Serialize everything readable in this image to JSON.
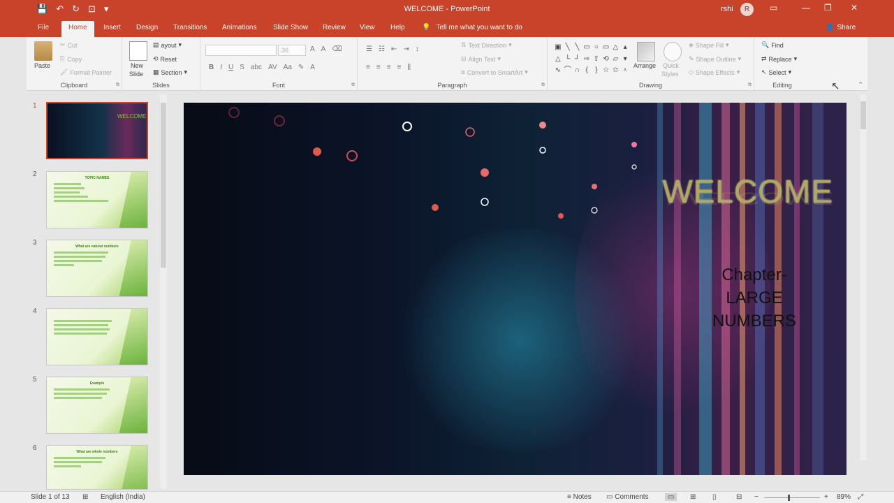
{
  "window": {
    "title": "WELCOME - PowerPoint",
    "user": "rshi",
    "avatar_initial": "R"
  },
  "qat": {
    "save_icon": "💾",
    "undo_icon": "↶",
    "redo_icon": "↻",
    "present_icon": "⊡",
    "more_icon": "▾"
  },
  "tabs": [
    "File",
    "Home",
    "Insert",
    "Design",
    "Transitions",
    "Animations",
    "Slide Show",
    "Review",
    "View",
    "Help"
  ],
  "tell_me": "Tell me what you want to do",
  "share": "Share",
  "ribbon": {
    "clipboard": {
      "label": "Clipboard",
      "paste": "Paste",
      "cut": "Cut",
      "copy": "Copy",
      "format_painter": "Format Painter"
    },
    "slides": {
      "label": "Slides",
      "new_slide": "New",
      "new_slide_2": "Slide",
      "layout": "ayout",
      "reset": "Reset",
      "section": "Section"
    },
    "font": {
      "label": "Font",
      "size": "36"
    },
    "paragraph": {
      "label": "Paragraph",
      "text_direction": "Text Direction",
      "align_text": "Align Text",
      "smartart": "Convert to SmartArt"
    },
    "drawing": {
      "label": "Drawing",
      "arrange": "Arrange",
      "quick_styles": "Quick",
      "quick_styles_2": "Styles",
      "shape_fill": "Shape Fill",
      "shape_outline": "Shape Outline",
      "shape_effects": "Shape Effects"
    },
    "editing": {
      "label": "Editing",
      "find": "Find",
      "replace": "Replace",
      "select": "Select"
    }
  },
  "thumbnails": [
    {
      "num": "1",
      "title": "WELCOME"
    },
    {
      "num": "2",
      "title": "TOPIC NAMES"
    },
    {
      "num": "3",
      "title": "What are natural numbers"
    },
    {
      "num": "4",
      "title": ""
    },
    {
      "num": "5",
      "title": "Example"
    },
    {
      "num": "6",
      "title": "What are whole numbers"
    }
  ],
  "slide": {
    "title": "WELCOME",
    "subtitle_1": "Chapter-",
    "subtitle_2": "LARGE",
    "subtitle_3": "NUMBERS"
  },
  "status": {
    "slide_info": "Slide 1 of 13",
    "language": "English (India)",
    "notes": "Notes",
    "comments": "Comments",
    "zoom": "89%"
  },
  "colors": {
    "accent": "#c8432a",
    "thumb_green": "#76b34a"
  }
}
